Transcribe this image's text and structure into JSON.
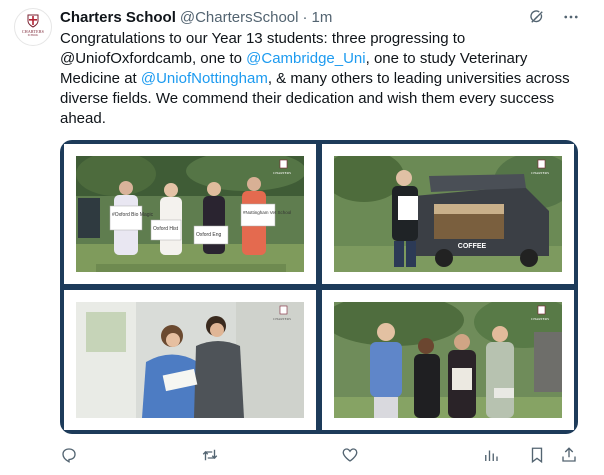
{
  "tweet": {
    "author_name": "Charters School",
    "author_handle": "@ChartersSchool",
    "separator": "·",
    "timestamp": "1m",
    "avatar_text": "CHARTERS",
    "avatar_sub": "SCHOOL",
    "text_parts": [
      "Congratulations to our Year 13 students: three progressing to @UniofOxfordcamb, one to ",
      "@Cambridge_Uni",
      ", one to study Veterinary Medicine at ",
      "@UniofNottingham",
      ", & many others to leading universities across diverse fields. We commend their dedication and wish them every success ahead."
    ]
  },
  "icons": {
    "grok": "grok-icon",
    "more": "more-icon",
    "reply": "reply-icon",
    "retweet": "retweet-icon",
    "like": "like-icon",
    "views": "views-icon",
    "bookmark": "bookmark-icon",
    "share": "share-icon"
  },
  "photos": {
    "sign_1": "#Oxford Bio Magic",
    "sign_2": "Oxford Hist",
    "sign_3": "Oxford Eng",
    "sign_4": "#Nottingham Vet School",
    "van_text": "COFFEE",
    "watermark": "CHARTERS"
  },
  "colors": {
    "accent": "#1d9bf0",
    "frame": "#1d3b5a",
    "school": "#7a2232"
  }
}
